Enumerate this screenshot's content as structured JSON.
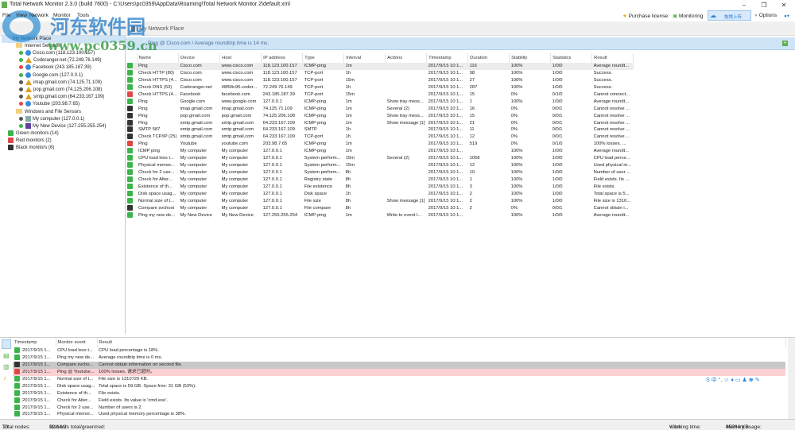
{
  "window": {
    "title": "Total Network Monitor 2.3.0 (build 7600) - C:\\Users\\pc0359\\AppData\\Roaming\\Total Network Monitor 2\\default.xml",
    "min": "–",
    "max": "❐",
    "close": "✕"
  },
  "menu": [
    "File",
    "View",
    "Network",
    "Monitor",
    "Tools"
  ],
  "toolbar": {
    "purchase": "Purchase license",
    "monitoring": "Monitoring",
    "upload": "拖拽上传",
    "options": "Options"
  },
  "breadcrumb": "My Network Place",
  "watermark": {
    "cn": "河东软件园",
    "url": "www.pc0359.cn"
  },
  "info": "Ping @ Cisco.com /  Average roundtrip time is 14 ms.",
  "tree": {
    "root": "My Network Place",
    "groups": [
      {
        "label": "Internet Sensors",
        "items": [
          {
            "label": "Cisco.com (118.123.100.157)",
            "status": "#3cb44b",
            "icon": "globe"
          },
          {
            "label": "Coderanger.net (72.249.76.149)",
            "status": "#3cb44b",
            "icon": "linux"
          },
          {
            "label": "Facebook (243.185.187.39)",
            "status": "#e04848",
            "icon": "globe"
          },
          {
            "label": "Google.com (127.0.0.1)",
            "status": "#3cb44b",
            "icon": "globe"
          },
          {
            "label": "imap.gmail.com (74.125.71.109)",
            "status": "#555555",
            "icon": "linux"
          },
          {
            "label": "pop.gmail.com (74.125.206.108)",
            "status": "#555555",
            "icon": "linux"
          },
          {
            "label": "smtp.gmail.com (64.233.167.109)",
            "status": "#555555",
            "icon": "linux"
          },
          {
            "label": "Youtube (203.98.7.65)",
            "status": "#e04848",
            "icon": "globe"
          }
        ]
      },
      {
        "label": "Windows and File Sensors",
        "items": [
          {
            "label": "My computer (127.0.0.1)",
            "status": "#555555",
            "icon": "computer"
          },
          {
            "label": "My New Device (127.255.255.254)",
            "status": "#3cb44b",
            "icon": "device"
          }
        ]
      }
    ],
    "summary": [
      {
        "label": "Green monitors (14)",
        "color": "#3cb44b"
      },
      {
        "label": "Red monitors (2)",
        "color": "#e04848"
      },
      {
        "label": "Black monitors (6)",
        "color": "#333333"
      }
    ]
  },
  "colors": {
    "green": "#3cb44b",
    "red": "#e04848",
    "black": "#333333"
  },
  "columns": [
    "Name",
    "Device",
    "Host",
    "IP address",
    "Type",
    "Interval",
    "Actions",
    "Timestamp",
    "Duration",
    "Stability",
    "Statistics",
    "Result"
  ],
  "rows": [
    [
      "g",
      "Ping",
      "Cisco.com",
      "www.cisco.com",
      "118.123.100.157",
      "ICMP-ping",
      "1m",
      "",
      "2017/9/15 10:1...",
      "116",
      "100%",
      "1/0/0",
      "Average roundt..."
    ],
    [
      "g",
      "Check HTTP (80)",
      "Cisco.com",
      "www.cisco.com",
      "118.123.100.157",
      "TCP-port",
      "1h",
      "",
      "2017/9/15 10:1...",
      "98",
      "100%",
      "1/0/0",
      "Success."
    ],
    [
      "g",
      "Check HTTPS (4...",
      "Cisco.com",
      "www.cisco.com",
      "118.123.100.157",
      "TCP-port",
      "15m",
      "",
      "2017/9/15 10:1...",
      "27",
      "100%",
      "1/0/0",
      "Success."
    ],
    [
      "g",
      "Check DNS (53)",
      "Coderanger.net",
      "48f94c95.coder...",
      "72.249.76.149",
      "TCP-port",
      "1h",
      "",
      "2017/9/15 10:1...",
      "287",
      "100%",
      "1/0/0",
      "Success."
    ],
    [
      "r",
      "Check HTTPS (4...",
      "Facebook",
      "facebook.com",
      "243.185.187.39",
      "TCP-port",
      "15m",
      "",
      "2017/9/15 10:1...",
      "15",
      "0%",
      "0/1/0",
      "Cannot connect..."
    ],
    [
      "g",
      "Ping",
      "Google.com",
      "www.google.com",
      "127.0.0.1",
      "ICMP-ping",
      "1m",
      "Show tray mess...",
      "2017/9/15 10:1...",
      "1",
      "100%",
      "1/0/0",
      "Average roundt..."
    ],
    [
      "b",
      "Ping",
      "imap.gmail.com",
      "imap.gmail.com",
      "74.125.71.109",
      "ICMP-ping",
      "1m",
      "Several (2)",
      "2017/9/15 10:1...",
      "16",
      "0%",
      "0/0/1",
      "Cannot resolve ..."
    ],
    [
      "b",
      "Ping",
      "pop.gmail.com",
      "pop.gmail.com",
      "74.125.206.108",
      "ICMP-ping",
      "1m",
      "Show tray mess...",
      "2017/9/15 10:1...",
      "15",
      "0%",
      "0/0/1",
      "Cannot resolve ..."
    ],
    [
      "b",
      "Ping",
      "smtp.gmail.com",
      "smtp.gmail.com",
      "64.233.167.109",
      "ICMP-ping",
      "1m",
      "Show message [1]",
      "2017/9/15 10:1...",
      "21",
      "0%",
      "0/0/1",
      "Cannot resolve ..."
    ],
    [
      "b",
      "SMTP 587",
      "smtp.gmail.com",
      "smtp.gmail.com",
      "64.233.167.109",
      "SMTP",
      "1h",
      "",
      "2017/9/15 10:1...",
      "11",
      "0%",
      "0/0/1",
      "Cannot resolve ..."
    ],
    [
      "b",
      "Check TCP/IP (25)",
      "smtp.gmail.com",
      "smtp.gmail.com",
      "64.233.167.109",
      "TCP-port",
      "1h",
      "",
      "2017/9/15 10:1...",
      "12",
      "0%",
      "0/0/1",
      "Cannot resolve ..."
    ],
    [
      "r",
      "Ping",
      "Youtube",
      "youtube.com",
      "203.98.7.65",
      "ICMP-ping",
      "1m",
      "",
      "2017/9/15 10:1...",
      "519",
      "0%",
      "0/1/0",
      "100% losses. ..."
    ],
    [
      "g",
      "ICMP ping",
      "My computer",
      "My computer",
      "127.0.0.1",
      "ICMP-ping",
      "1m",
      "",
      "2017/9/15 10:1...",
      "",
      "100%",
      "1/0/0",
      "Average roundt..."
    ],
    [
      "g",
      "CPU load less t...",
      "My computer",
      "My computer",
      "127.0.0.1",
      "System perform...",
      "15m",
      "Several (2)",
      "2017/9/15 10:1...",
      "1058",
      "100%",
      "1/0/0",
      "CPU load perce..."
    ],
    [
      "g",
      "Physical memor...",
      "My computer",
      "My computer",
      "127.0.0.1",
      "System perform...",
      "15m",
      "",
      "2017/9/15 10:1...",
      "12",
      "100%",
      "1/0/0",
      "Used physical m..."
    ],
    [
      "g",
      "Check for 2 use...",
      "My computer",
      "My computer",
      "127.0.0.1",
      "System perform...",
      "8h",
      "",
      "2017/9/15 10:1...",
      "10",
      "100%",
      "1/0/0",
      "Number of user ..."
    ],
    [
      "g",
      "Check for Alter...",
      "My computer",
      "My computer",
      "127.0.0.1",
      "Registry state",
      "8h",
      "",
      "2017/9/15 10:1...",
      "1",
      "100%",
      "1/0/0",
      "Field exists. Its ..."
    ],
    [
      "g",
      "Existence of th...",
      "My computer",
      "My computer",
      "127.0.0.1",
      "File existence",
      "8h",
      "",
      "2017/9/15 10:1...",
      "3",
      "100%",
      "1/0/0",
      "File exists."
    ],
    [
      "g",
      "Disk space usag...",
      "My computer",
      "My computer",
      "127.0.0.1",
      "Disk space",
      "1h",
      "",
      "2017/9/15 10:1...",
      "2",
      "100%",
      "1/0/0",
      "Total space is 5..."
    ],
    [
      "g",
      "Normal size of t...",
      "My computer",
      "My computer",
      "127.0.0.1",
      "File size",
      "8h",
      "Show message [1]",
      "2017/9/15 10:1...",
      "2",
      "100%",
      "1/0/0",
      "File size is 1310..."
    ],
    [
      "b",
      "Compare svchost",
      "My computer",
      "My computer",
      "127.0.0.1",
      "File compare",
      "8h",
      "",
      "2017/9/15 10:1...",
      "2",
      "0%",
      "0/0/1",
      "Cannot obtain i..."
    ],
    [
      "g",
      "Ping my new de...",
      "My New Device",
      "My New Device",
      "127.255.255.254",
      "ICMP-ping",
      "1m",
      "Write to event l...",
      "2017/9/15 10:1...",
      "",
      "100%",
      "1/0/0",
      "Average roundt..."
    ]
  ],
  "log": {
    "columns": [
      "Timestamp",
      "Monitor event",
      "Result"
    ],
    "rows": [
      [
        "g",
        "2017/9/15 1...",
        "CPU load less t...",
        "CPU load percentage is 18%."
      ],
      [
        "g",
        "2017/9/15 1...",
        "Ping my new de...",
        "Average roundtrip time is 0 ms."
      ],
      [
        "b",
        "2017/9/15 1...",
        "Compare svcho...",
        "Cannot obtain information on second file."
      ],
      [
        "r",
        "2017/9/15 1...",
        "Ping @ Youtube...",
        "100% losses. 请求已超时。"
      ],
      [
        "g",
        "2017/9/15 1...",
        "Normal size of t...",
        "File size is 1310720 KB."
      ],
      [
        "g",
        "2017/9/15 1...",
        "Disk space usag...",
        "Total space is 59 GB. Space free: 31 GB (53%)."
      ],
      [
        "g",
        "2017/9/15 1...",
        "Existence of th...",
        "File exists."
      ],
      [
        "g",
        "2017/9/15 1...",
        "Check for Alter...",
        "Field exists. Its value is 'cmd.exe'."
      ],
      [
        "g",
        "2017/9/15 1...",
        "Check for 2 use...",
        "Number of users is 2."
      ],
      [
        "g",
        "2017/9/15 1...",
        "Physical memor...",
        "Used physical memory percentage is 38%."
      ]
    ]
  },
  "status": {
    "nodes_label": "Total nodes:",
    "nodes": "10",
    "monitors_label": "Monitors total/green/red:",
    "monitors": "22/14/2",
    "working_label": "Working time:",
    "working": "< 1m",
    "memory_label": "Memory usage:",
    "memory": "45084 KB"
  },
  "ime": "S 中 °, ☺ ♦ ▭ ♟ ♚ ✎"
}
